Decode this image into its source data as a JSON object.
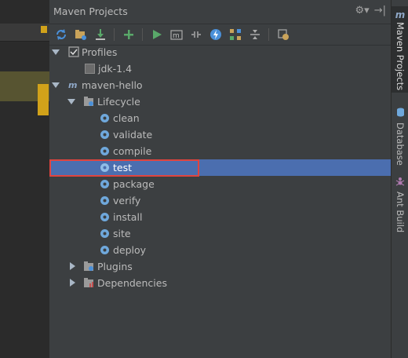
{
  "panel": {
    "title": "Maven Projects",
    "settings_icon": "gear-icon",
    "hide_icon": "hide-panel-icon"
  },
  "toolbar": {
    "buttons": [
      {
        "name": "reimport",
        "icon": "refresh-icon"
      },
      {
        "name": "generate-sources",
        "icon": "folder-gear-icon"
      },
      {
        "name": "download",
        "icon": "download-icon"
      },
      {
        "name": "add",
        "icon": "plus-icon"
      },
      {
        "name": "run",
        "icon": "play-icon"
      },
      {
        "name": "execute-goal",
        "icon": "maven-m-icon"
      },
      {
        "name": "toggle-offline",
        "icon": "offline-icon"
      },
      {
        "name": "skip-tests",
        "icon": "lightning-icon"
      },
      {
        "name": "show-dependencies",
        "icon": "dependencies-icon"
      },
      {
        "name": "collapse-all",
        "icon": "collapse-icon"
      },
      {
        "name": "settings",
        "icon": "wrench-icon"
      }
    ]
  },
  "tree": {
    "profiles": {
      "label": "Profiles",
      "children": [
        "jdk-1.4"
      ]
    },
    "project": {
      "label": "maven-hello",
      "lifecycle": {
        "label": "Lifecycle",
        "goals": [
          "clean",
          "validate",
          "compile",
          "test",
          "package",
          "verify",
          "install",
          "site",
          "deploy"
        ],
        "selected": "test"
      },
      "plugins": {
        "label": "Plugins"
      },
      "dependencies": {
        "label": "Dependencies"
      }
    }
  },
  "side_tabs": [
    {
      "label": "Maven Projects",
      "icon": "maven-m-icon",
      "active": true
    },
    {
      "label": "Database",
      "icon": "database-icon",
      "active": false
    },
    {
      "label": "Ant Build",
      "icon": "ant-icon",
      "active": false
    }
  ],
  "colors": {
    "panel_bg": "#3c3f41",
    "selection": "#4b6eaf",
    "highlight_box": "#e0443f",
    "run_green": "#59a869",
    "goal_blue": "#6fa8dc"
  }
}
